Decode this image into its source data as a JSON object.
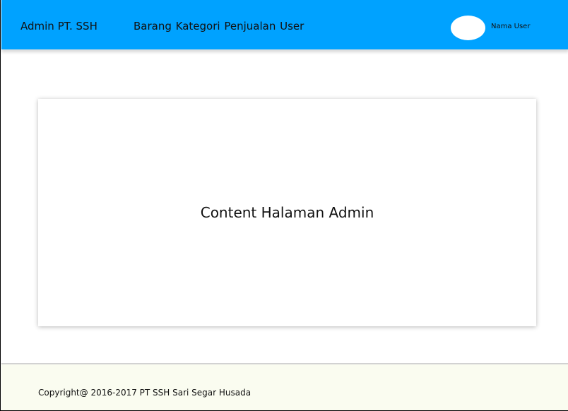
{
  "header": {
    "brand": "Admin PT. SSH",
    "nav": [
      {
        "label": "Barang"
      },
      {
        "label": "Kategori"
      },
      {
        "label": "Penjualan"
      },
      {
        "label": "User"
      }
    ],
    "user_name": "Nama User",
    "background_color": "#00a2ff"
  },
  "main": {
    "content_text": "Content Halaman Admin"
  },
  "footer": {
    "copyright": "Copyright@ 2016-2017 PT SSH Sari Segar Husada",
    "background_color": "#fafcf0"
  }
}
